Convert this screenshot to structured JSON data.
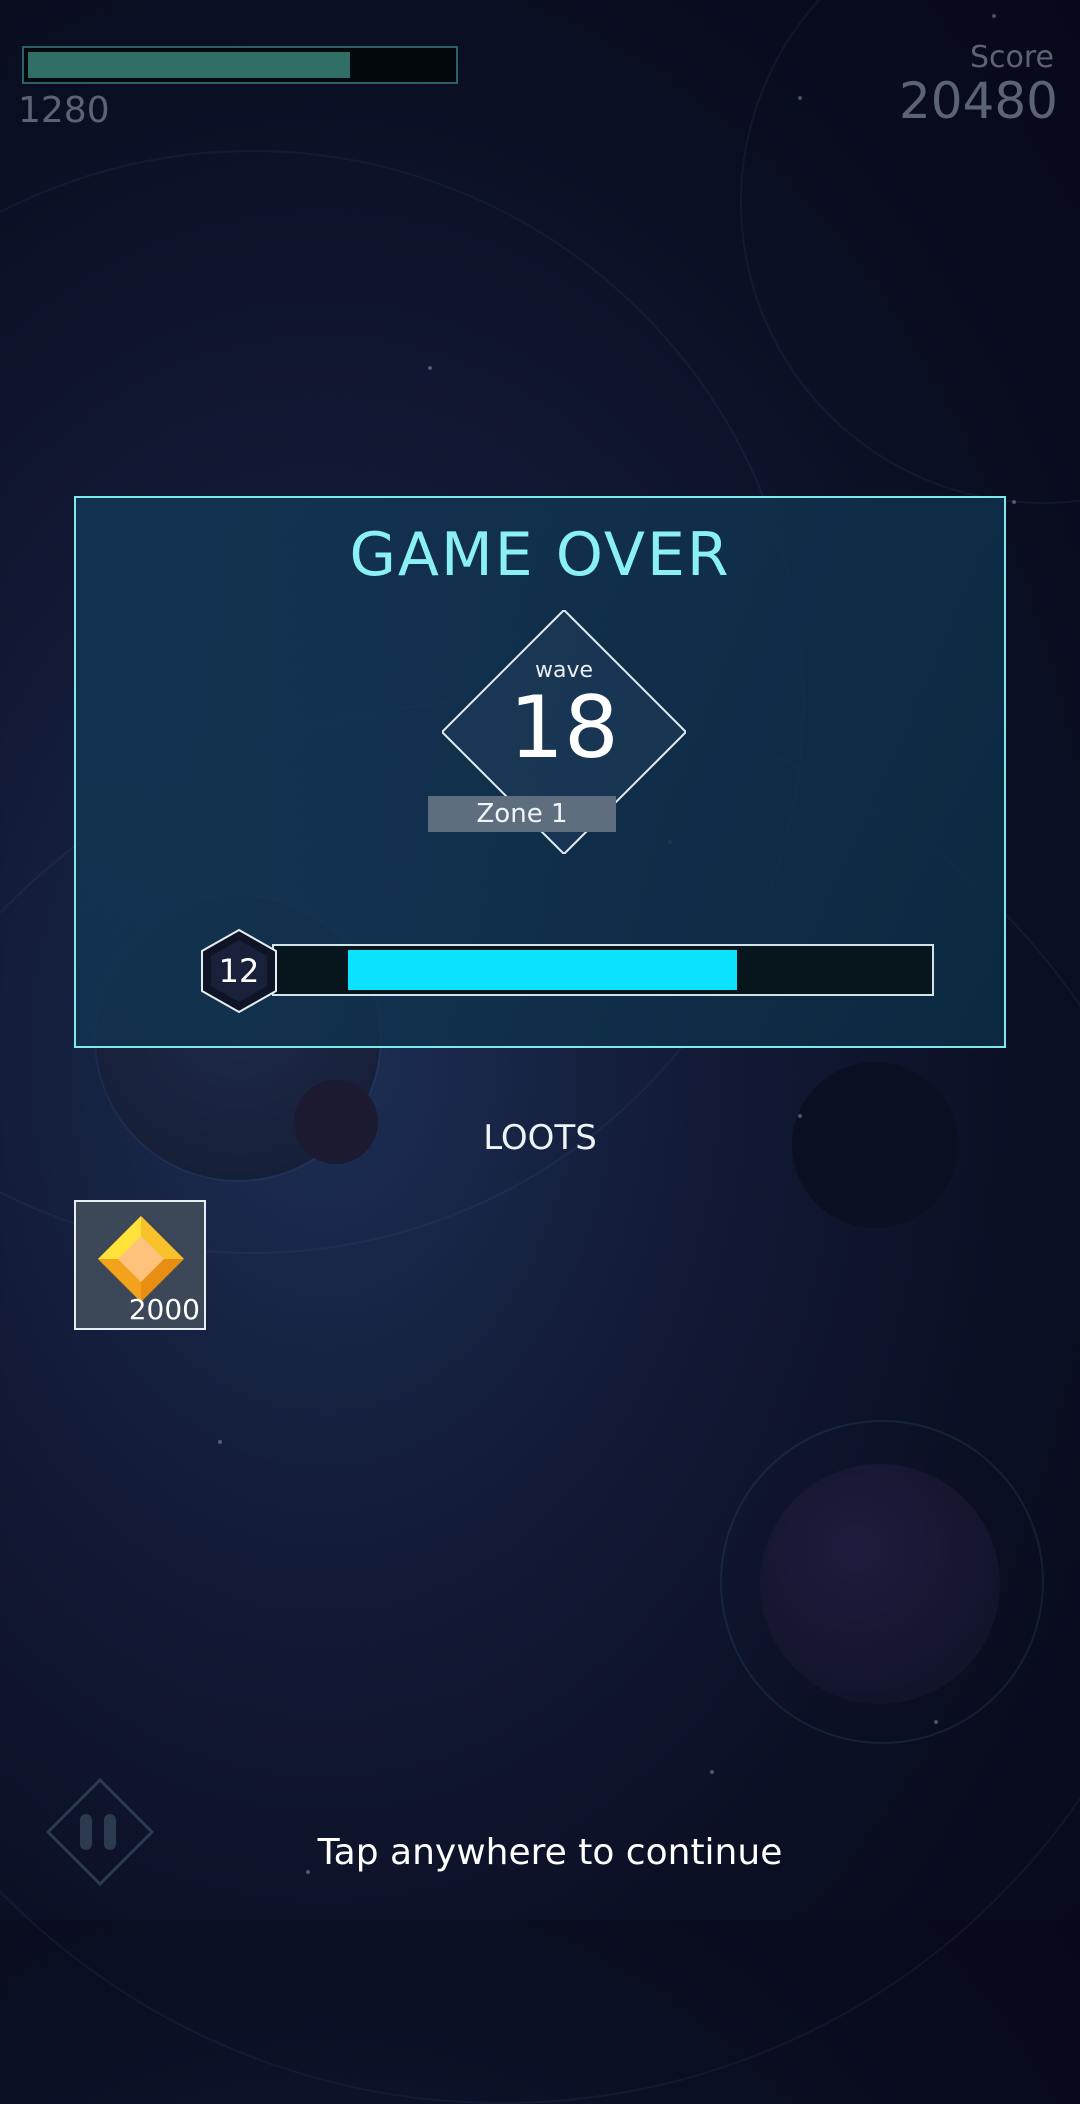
{
  "hud": {
    "health_value": "1280",
    "health_fraction": 0.76,
    "score_label": "Score",
    "score_value": "20480"
  },
  "game_over": {
    "title": "GAME OVER",
    "wave_label": "wave",
    "wave_number": "18",
    "zone_label": "Zone 1",
    "level": "12",
    "xp_fraction": 0.67
  },
  "loots": {
    "title": "LOOTS",
    "items": [
      {
        "icon": "gold-gem-icon",
        "amount": "2000"
      }
    ]
  },
  "footer": {
    "continue_text": "Tap anywhere to continue",
    "pause_icon": "pause-icon"
  },
  "colors": {
    "accent_cyan": "#0be2ff",
    "panel_border": "#7fe8ef",
    "health_fill": "#2f6f66",
    "gem_gold": "#f2b21b"
  }
}
